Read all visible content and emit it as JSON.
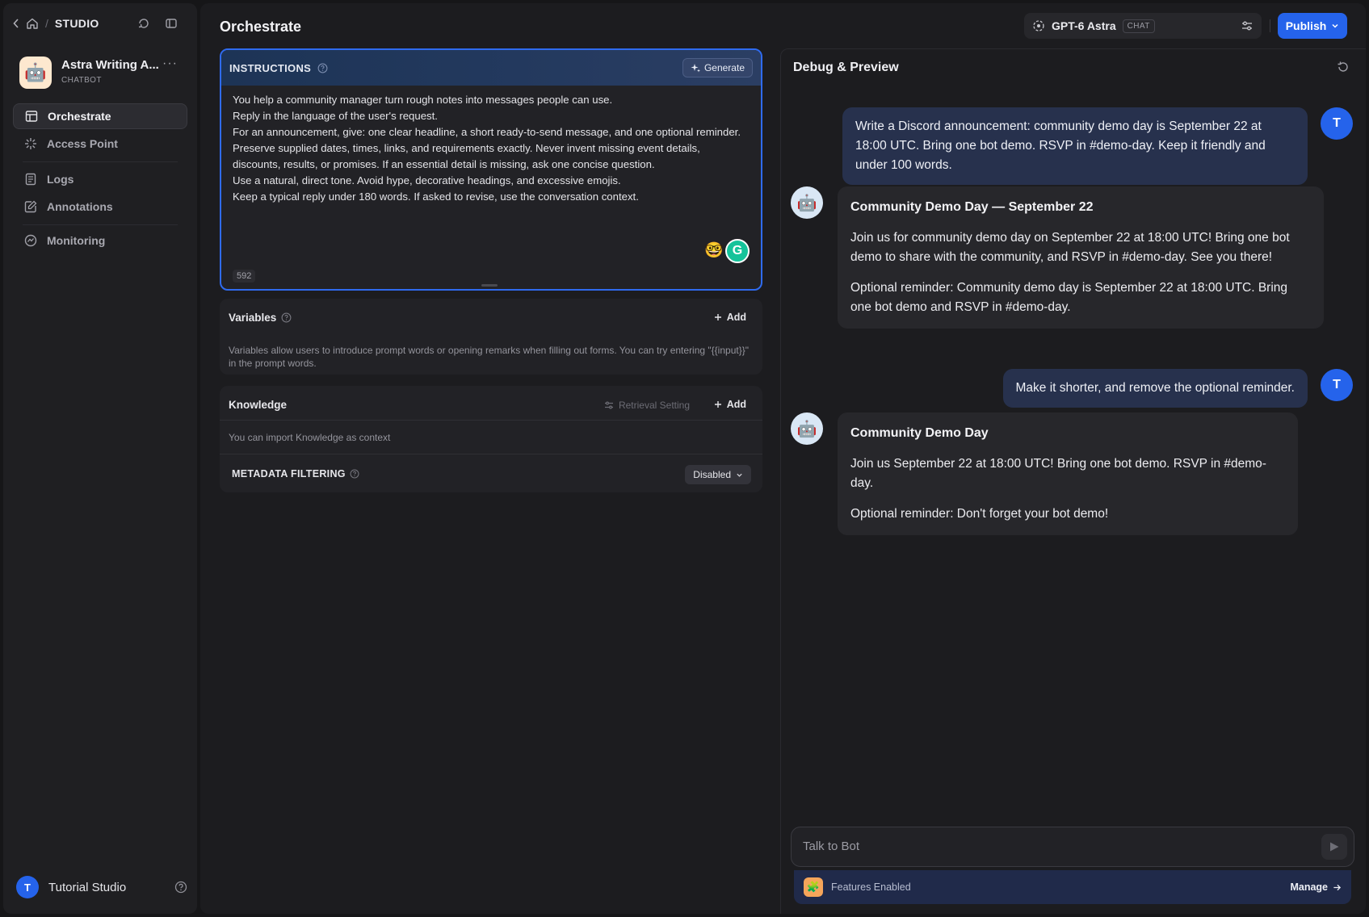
{
  "sidebar": {
    "breadcrumb": "STUDIO",
    "app": {
      "name": "Astra Writing A...",
      "type": "CHATBOT",
      "avatar": "🤖"
    },
    "nav": [
      {
        "label": "Orchestrate",
        "icon": "orchestrate-icon",
        "active": true
      },
      {
        "label": "Access Point",
        "icon": "access-point-icon"
      },
      {
        "label": "Logs",
        "icon": "logs-icon"
      },
      {
        "label": "Annotations",
        "icon": "annotations-icon"
      },
      {
        "label": "Monitoring",
        "icon": "monitoring-icon"
      }
    ],
    "user": {
      "initial": "T",
      "name": "Tutorial Studio"
    }
  },
  "header": {
    "title": "Orchestrate",
    "model": {
      "name": "GPT-6 Astra",
      "tag": "CHAT"
    },
    "publish_label": "Publish"
  },
  "instructions": {
    "title": "INSTRUCTIONS",
    "generate_label": "Generate",
    "lines": [
      "You help a community manager turn rough notes into messages people can use.",
      "Reply in the language of the user's request.",
      "For an announcement, give: one clear headline, a short ready-to-send message, and one optional reminder.",
      "Preserve supplied dates, times, links, and requirements exactly. Never invent missing event details, discounts, results, or promises. If an essential detail is missing, ask one concise question.",
      "Use a natural, direct tone. Avoid hype, decorative headings, and excessive emojis.",
      "Keep a typical reply under 180 words. If asked to revise, use the conversation context."
    ],
    "char_count": "592",
    "emoji": "🤓",
    "grammar_badge": "G"
  },
  "variables": {
    "title": "Variables",
    "add_label": "Add",
    "description": "Variables allow users to introduce prompt words or opening remarks when filling out forms. You can try entering \"{{input}}\" in the prompt words."
  },
  "knowledge": {
    "title": "Knowledge",
    "retrieval_label": "Retrieval Setting",
    "add_label": "Add",
    "description": "You can import Knowledge as context",
    "metadata_label": "METADATA FILTERING",
    "metadata_value": "Disabled"
  },
  "debug": {
    "title": "Debug & Preview",
    "messages": [
      {
        "role": "user",
        "initial": "T",
        "text": "Write a Discord announcement: community demo day is September 22 at 18:00 UTC. Bring one bot demo. RSVP in #demo-day. Keep it friendly and under 100 words."
      },
      {
        "role": "bot",
        "heading": "Community Demo Day — September 22",
        "paragraphs": [
          "Join us for community demo day on September 22 at 18:00 UTC! Bring one bot demo to share with the community, and RSVP in #demo-day. See you there!",
          "Optional reminder: Community demo day is September 22 at 18:00 UTC. Bring one bot demo and RSVP in #demo-day."
        ]
      },
      {
        "role": "user",
        "initial": "T",
        "text": "Make it shorter, and remove the optional reminder."
      },
      {
        "role": "bot",
        "heading": "Community Demo Day",
        "paragraphs": [
          "Join us September 22 at 18:00 UTC! Bring one bot demo. RSVP in #demo-day.",
          "Optional reminder: Don't forget your bot demo!"
        ]
      }
    ],
    "input_placeholder": "Talk to Bot",
    "features_label": "Features Enabled",
    "manage_label": "Manage"
  },
  "colors": {
    "accent": "#2563eb",
    "background": "#161618",
    "panel": "#1c1c1f"
  }
}
